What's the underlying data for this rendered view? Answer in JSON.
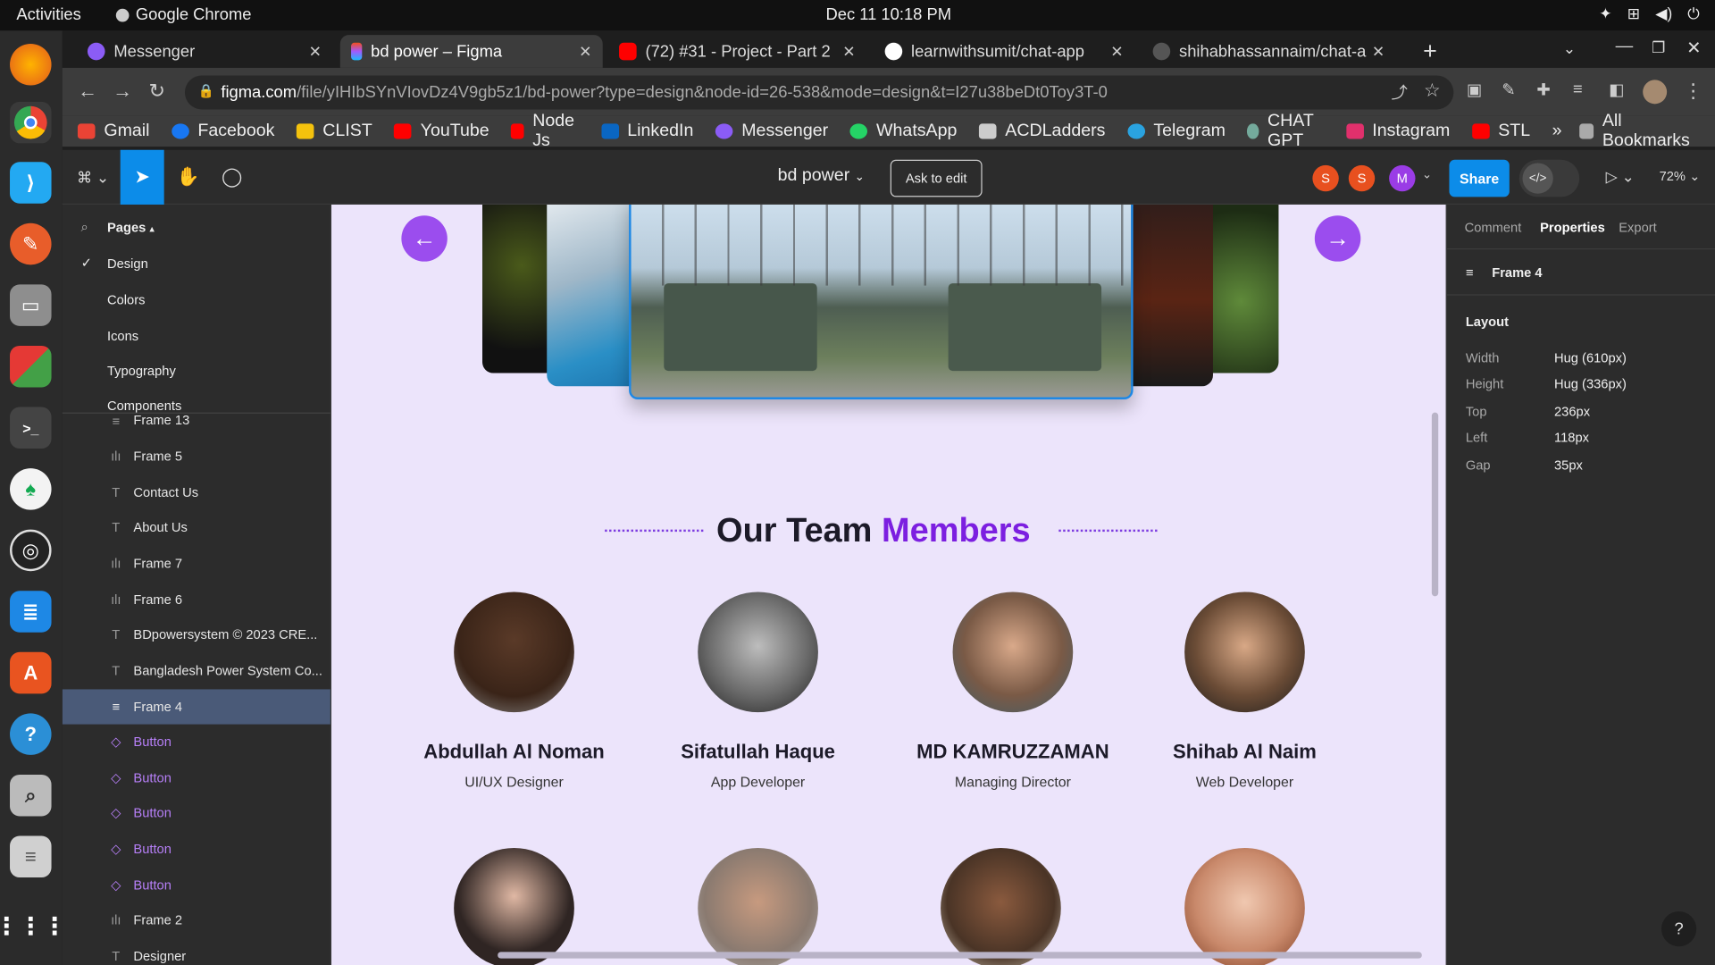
{
  "system": {
    "activities": "Activities",
    "app_name": "Google Chrome",
    "clock": "Dec 11  10:18 PM"
  },
  "browser": {
    "tabs": [
      {
        "label": "Messenger",
        "color": "#8b5cf6"
      },
      {
        "label": "bd power – Figma",
        "color": "#f24e1e"
      },
      {
        "label": "(72) #31 - Project - Part 2",
        "color": "#ff0000"
      },
      {
        "label": "learnwithsumit/chat-app",
        "color": "#ffffff"
      },
      {
        "label": "shihabhassannaim/chat-a",
        "color": "#666666"
      }
    ],
    "url_host": "figma.com",
    "url_path": "/file/yIHIbSYnVIovDz4V9gb5z1/bd-power?type=design&node-id=26-538&mode=design&t=I27u38beDt0Toy3T-0",
    "bookmarks": [
      {
        "label": "Gmail",
        "color": "#ea4335"
      },
      {
        "label": "Facebook",
        "color": "#1877f2"
      },
      {
        "label": "CLIST",
        "color": "#f4c20d"
      },
      {
        "label": "YouTube",
        "color": "#ff0000"
      },
      {
        "label": "Node Js",
        "color": "#ff0000"
      },
      {
        "label": "LinkedIn",
        "color": "#0a66c2"
      },
      {
        "label": "Messenger",
        "color": "#8b5cf6"
      },
      {
        "label": "WhatsApp",
        "color": "#25d366"
      },
      {
        "label": "ACDLadders",
        "color": "#cccccc"
      },
      {
        "label": "Telegram",
        "color": "#2aa3e0"
      },
      {
        "label": "CHAT GPT",
        "color": "#74aa9c"
      },
      {
        "label": "Instagram",
        "color": "#e1306c"
      },
      {
        "label": "STL",
        "color": "#ff0000"
      }
    ],
    "more": "»",
    "all_bookmarks": "All Bookmarks"
  },
  "figma": {
    "file_name": "bd power",
    "ask_to_edit": "Ask to edit",
    "avatars": [
      {
        "letter": "S",
        "color": "#e8501f"
      },
      {
        "letter": "S",
        "color": "#e8501f"
      },
      {
        "letter": "M",
        "color": "#9a3ce6"
      }
    ],
    "share": "Share",
    "dev_toggle": "</>",
    "zoom": "72%",
    "pages_header": "Pages",
    "pages": [
      "Design",
      "Colors",
      "Icons",
      "Typography",
      "Components"
    ],
    "current_page": "Design",
    "layers": [
      {
        "name": "Frame 13",
        "icon": "≡",
        "type": "frame"
      },
      {
        "name": "Frame 5",
        "icon": "ılı",
        "type": "frame"
      },
      {
        "name": "Contact Us",
        "icon": "T",
        "type": "text"
      },
      {
        "name": "About Us",
        "icon": "T",
        "type": "text"
      },
      {
        "name": "Frame 7",
        "icon": "ılı",
        "type": "frame"
      },
      {
        "name": "Frame 6",
        "icon": "ılı",
        "type": "frame"
      },
      {
        "name": "BDpowersystem © 2023 CRE...",
        "icon": "T",
        "type": "text"
      },
      {
        "name": "Bangladesh Power System Co...",
        "icon": "T",
        "type": "text"
      },
      {
        "name": "Frame 4",
        "icon": "≡",
        "type": "selected"
      },
      {
        "name": "Button",
        "icon": "◇",
        "type": "component"
      },
      {
        "name": "Button",
        "icon": "◇",
        "type": "component"
      },
      {
        "name": "Button",
        "icon": "◇",
        "type": "component"
      },
      {
        "name": "Button",
        "icon": "◇",
        "type": "component"
      },
      {
        "name": "Button",
        "icon": "◇",
        "type": "component"
      },
      {
        "name": "Frame 2",
        "icon": "ılı",
        "type": "frame"
      },
      {
        "name": "Designer",
        "icon": "T",
        "type": "text"
      }
    ],
    "right_tabs": [
      "Comment",
      "Properties",
      "Export"
    ],
    "active_right_tab": "Properties",
    "selection_name": "Frame 4",
    "layout_title": "Layout",
    "props": [
      {
        "label": "Width",
        "value": "Hug (610px)"
      },
      {
        "label": "Height",
        "value": "Hug (336px)"
      },
      {
        "label": "Top",
        "value": "236px"
      },
      {
        "label": "Left",
        "value": "118px"
      },
      {
        "label": "Gap",
        "value": "35px"
      }
    ]
  },
  "canvas": {
    "heading_main": "Our Team ",
    "heading_accent": "Members",
    "accent_color": "#7c1fe0",
    "members": [
      {
        "name": "Abdullah Al Noman",
        "role": "UI/UX Designer",
        "tone": "#3a2418"
      },
      {
        "name": "Sifatullah Haque",
        "role": "App Developer",
        "tone": "#555555"
      },
      {
        "name": "MD KAMRUZZAMAN",
        "role": "Managing Director",
        "tone": "#7a5a46"
      },
      {
        "name": "Shihab Al Naim",
        "role": "Web Developer",
        "tone": "#6b4c36"
      }
    ],
    "members_row2": [
      {
        "tone": "#2f2523"
      },
      {
        "tone": "#8a7a70"
      },
      {
        "tone": "#4a3426"
      },
      {
        "tone": "#c9896b"
      }
    ]
  }
}
